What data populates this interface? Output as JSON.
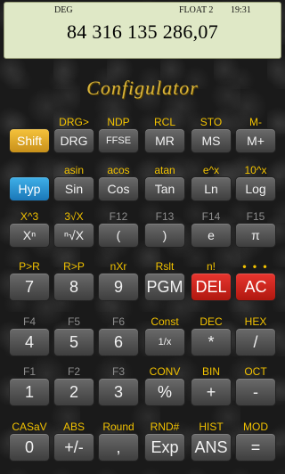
{
  "display": {
    "angle_mode": "DEG",
    "format_mode": "FLOAT 2",
    "time": "19:31",
    "value": "84 316 135 286,07"
  },
  "title": "Configulator",
  "rows": [
    [
      {
        "top": "",
        "key": "Shift",
        "name": "shift"
      },
      {
        "top": "DRG>",
        "key": "DRG",
        "name": "drg"
      },
      {
        "top": "NDP",
        "key": "FFSE",
        "name": "ffse"
      },
      {
        "top": "RCL",
        "key": "MR",
        "name": "mr"
      },
      {
        "top": "STO",
        "key": "MS",
        "name": "ms"
      },
      {
        "top": "M-",
        "key": "M+",
        "name": "m-plus"
      }
    ],
    [
      {
        "top": "",
        "key": "Hyp",
        "name": "hyp"
      },
      {
        "top": "asin",
        "key": "Sin",
        "name": "sin"
      },
      {
        "top": "acos",
        "key": "Cos",
        "name": "cos"
      },
      {
        "top": "atan",
        "key": "Tan",
        "name": "tan"
      },
      {
        "top": "e^x",
        "key": "Ln",
        "name": "ln"
      },
      {
        "top": "10^x",
        "key": "Log",
        "name": "log"
      }
    ],
    [
      {
        "top": "X^3",
        "key": "Xⁿ",
        "name": "power"
      },
      {
        "top": "3√X",
        "key": "ⁿ√X",
        "name": "root"
      },
      {
        "top": "F12",
        "key": "(",
        "name": "open-paren"
      },
      {
        "top": "F13",
        "key": ")",
        "name": "close-paren"
      },
      {
        "top": "F14",
        "key": "e",
        "name": "e-const"
      },
      {
        "top": "F15",
        "key": "π",
        "name": "pi"
      }
    ],
    [
      {
        "top": "P>R",
        "key": "7",
        "name": "digit-7"
      },
      {
        "top": "R>P",
        "key": "8",
        "name": "digit-8"
      },
      {
        "top": "nXr",
        "key": "9",
        "name": "digit-9"
      },
      {
        "top": "Rslt",
        "key": "PGM",
        "name": "pgm"
      },
      {
        "top": "n!",
        "key": "DEL",
        "name": "del"
      },
      {
        "top": "• • •",
        "key": "AC",
        "name": "ac"
      }
    ],
    [
      {
        "top": "F4",
        "key": "4",
        "name": "digit-4"
      },
      {
        "top": "F5",
        "key": "5",
        "name": "digit-5"
      },
      {
        "top": "F6",
        "key": "6",
        "name": "digit-6"
      },
      {
        "top": "Const",
        "key": "1/x",
        "name": "reciprocal"
      },
      {
        "top": "DEC",
        "key": "*",
        "name": "multiply"
      },
      {
        "top": "HEX",
        "key": "/",
        "name": "divide"
      }
    ],
    [
      {
        "top": "F1",
        "key": "1",
        "name": "digit-1"
      },
      {
        "top": "F2",
        "key": "2",
        "name": "digit-2"
      },
      {
        "top": "F3",
        "key": "3",
        "name": "digit-3"
      },
      {
        "top": "CONV",
        "key": "%",
        "name": "percent"
      },
      {
        "top": "BIN",
        "key": "+",
        "name": "plus"
      },
      {
        "top": "OCT",
        "key": "-",
        "name": "minus"
      }
    ],
    [
      {
        "top": "CASaV",
        "key": "0",
        "name": "digit-0"
      },
      {
        "top": "ABS",
        "key": "+/-",
        "name": "sign"
      },
      {
        "top": "Round",
        "key": ",",
        "name": "decimal"
      },
      {
        "top": "RND#",
        "key": "Exp",
        "name": "exp"
      },
      {
        "top": "HIST",
        "key": "ANS",
        "name": "ans"
      },
      {
        "top": "MOD",
        "key": "=",
        "name": "equals"
      }
    ]
  ],
  "colors": {
    "accent": "#f2c200",
    "shift": "#e0a82a",
    "hyp": "#2a93d6",
    "danger": "#d4251d"
  }
}
